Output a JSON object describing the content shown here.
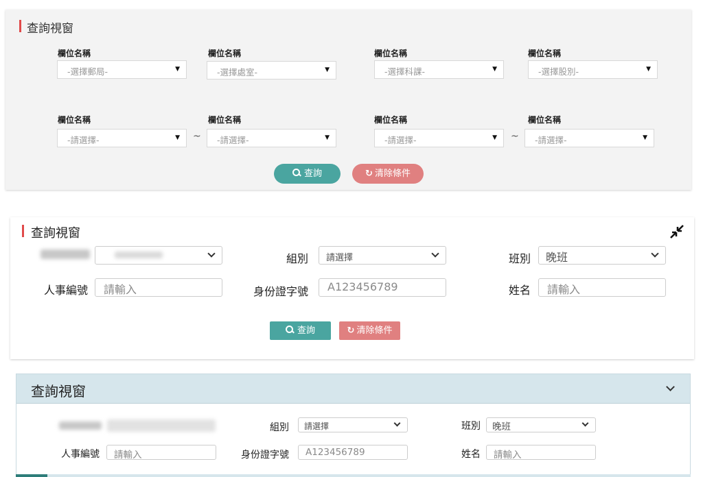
{
  "panel1": {
    "title": "查詢視窗",
    "row1": [
      {
        "label": "欄位名稱",
        "value": "-選擇郵局-"
      },
      {
        "label": "欄位名稱",
        "value": "-選擇處室-"
      },
      {
        "label": "欄位名稱",
        "value": "-選擇科課-"
      },
      {
        "label": "欄位名稱",
        "value": "-選擇股別-"
      }
    ],
    "row2": [
      {
        "label": "欄位名稱",
        "value": "-請選擇-"
      },
      {
        "label": "欄位名稱",
        "value": "-請選擇-"
      },
      {
        "label": "欄位名稱",
        "value": "-請選擇-"
      },
      {
        "label": "欄位名稱",
        "value": "-請選擇-"
      }
    ],
    "range_separator": "~",
    "search_label": "查詢",
    "clear_label": "清除條件"
  },
  "panel2": {
    "title": "查詢視窗",
    "group_label": "組別",
    "group_value": "請選擇",
    "shift_label": "班別",
    "shift_value": "晚班",
    "staff_id_label": "人事編號",
    "staff_id_placeholder": "請輸入",
    "id_no_label": "身份證字號",
    "id_no_value": "A123456789",
    "name_label": "姓名",
    "name_placeholder": "請輸入",
    "search_label": "查詢",
    "clear_label": "清除條件"
  },
  "panel3": {
    "title": "查詢視窗",
    "group_label": "組別",
    "group_value": "請選擇",
    "shift_label": "班別",
    "shift_value": "晚班",
    "staff_id_label": "人事編號",
    "staff_id_placeholder": "請輸入",
    "id_no_label": "身份證字號",
    "id_no_value": "A123456789",
    "name_label": "姓名",
    "name_placeholder": "請輸入"
  },
  "colors": {
    "accent_teal": "#4aa5a0",
    "clear_red": "#e08080",
    "title_marker": "#e04a4a",
    "panel3_header": "#d6e6ec"
  }
}
